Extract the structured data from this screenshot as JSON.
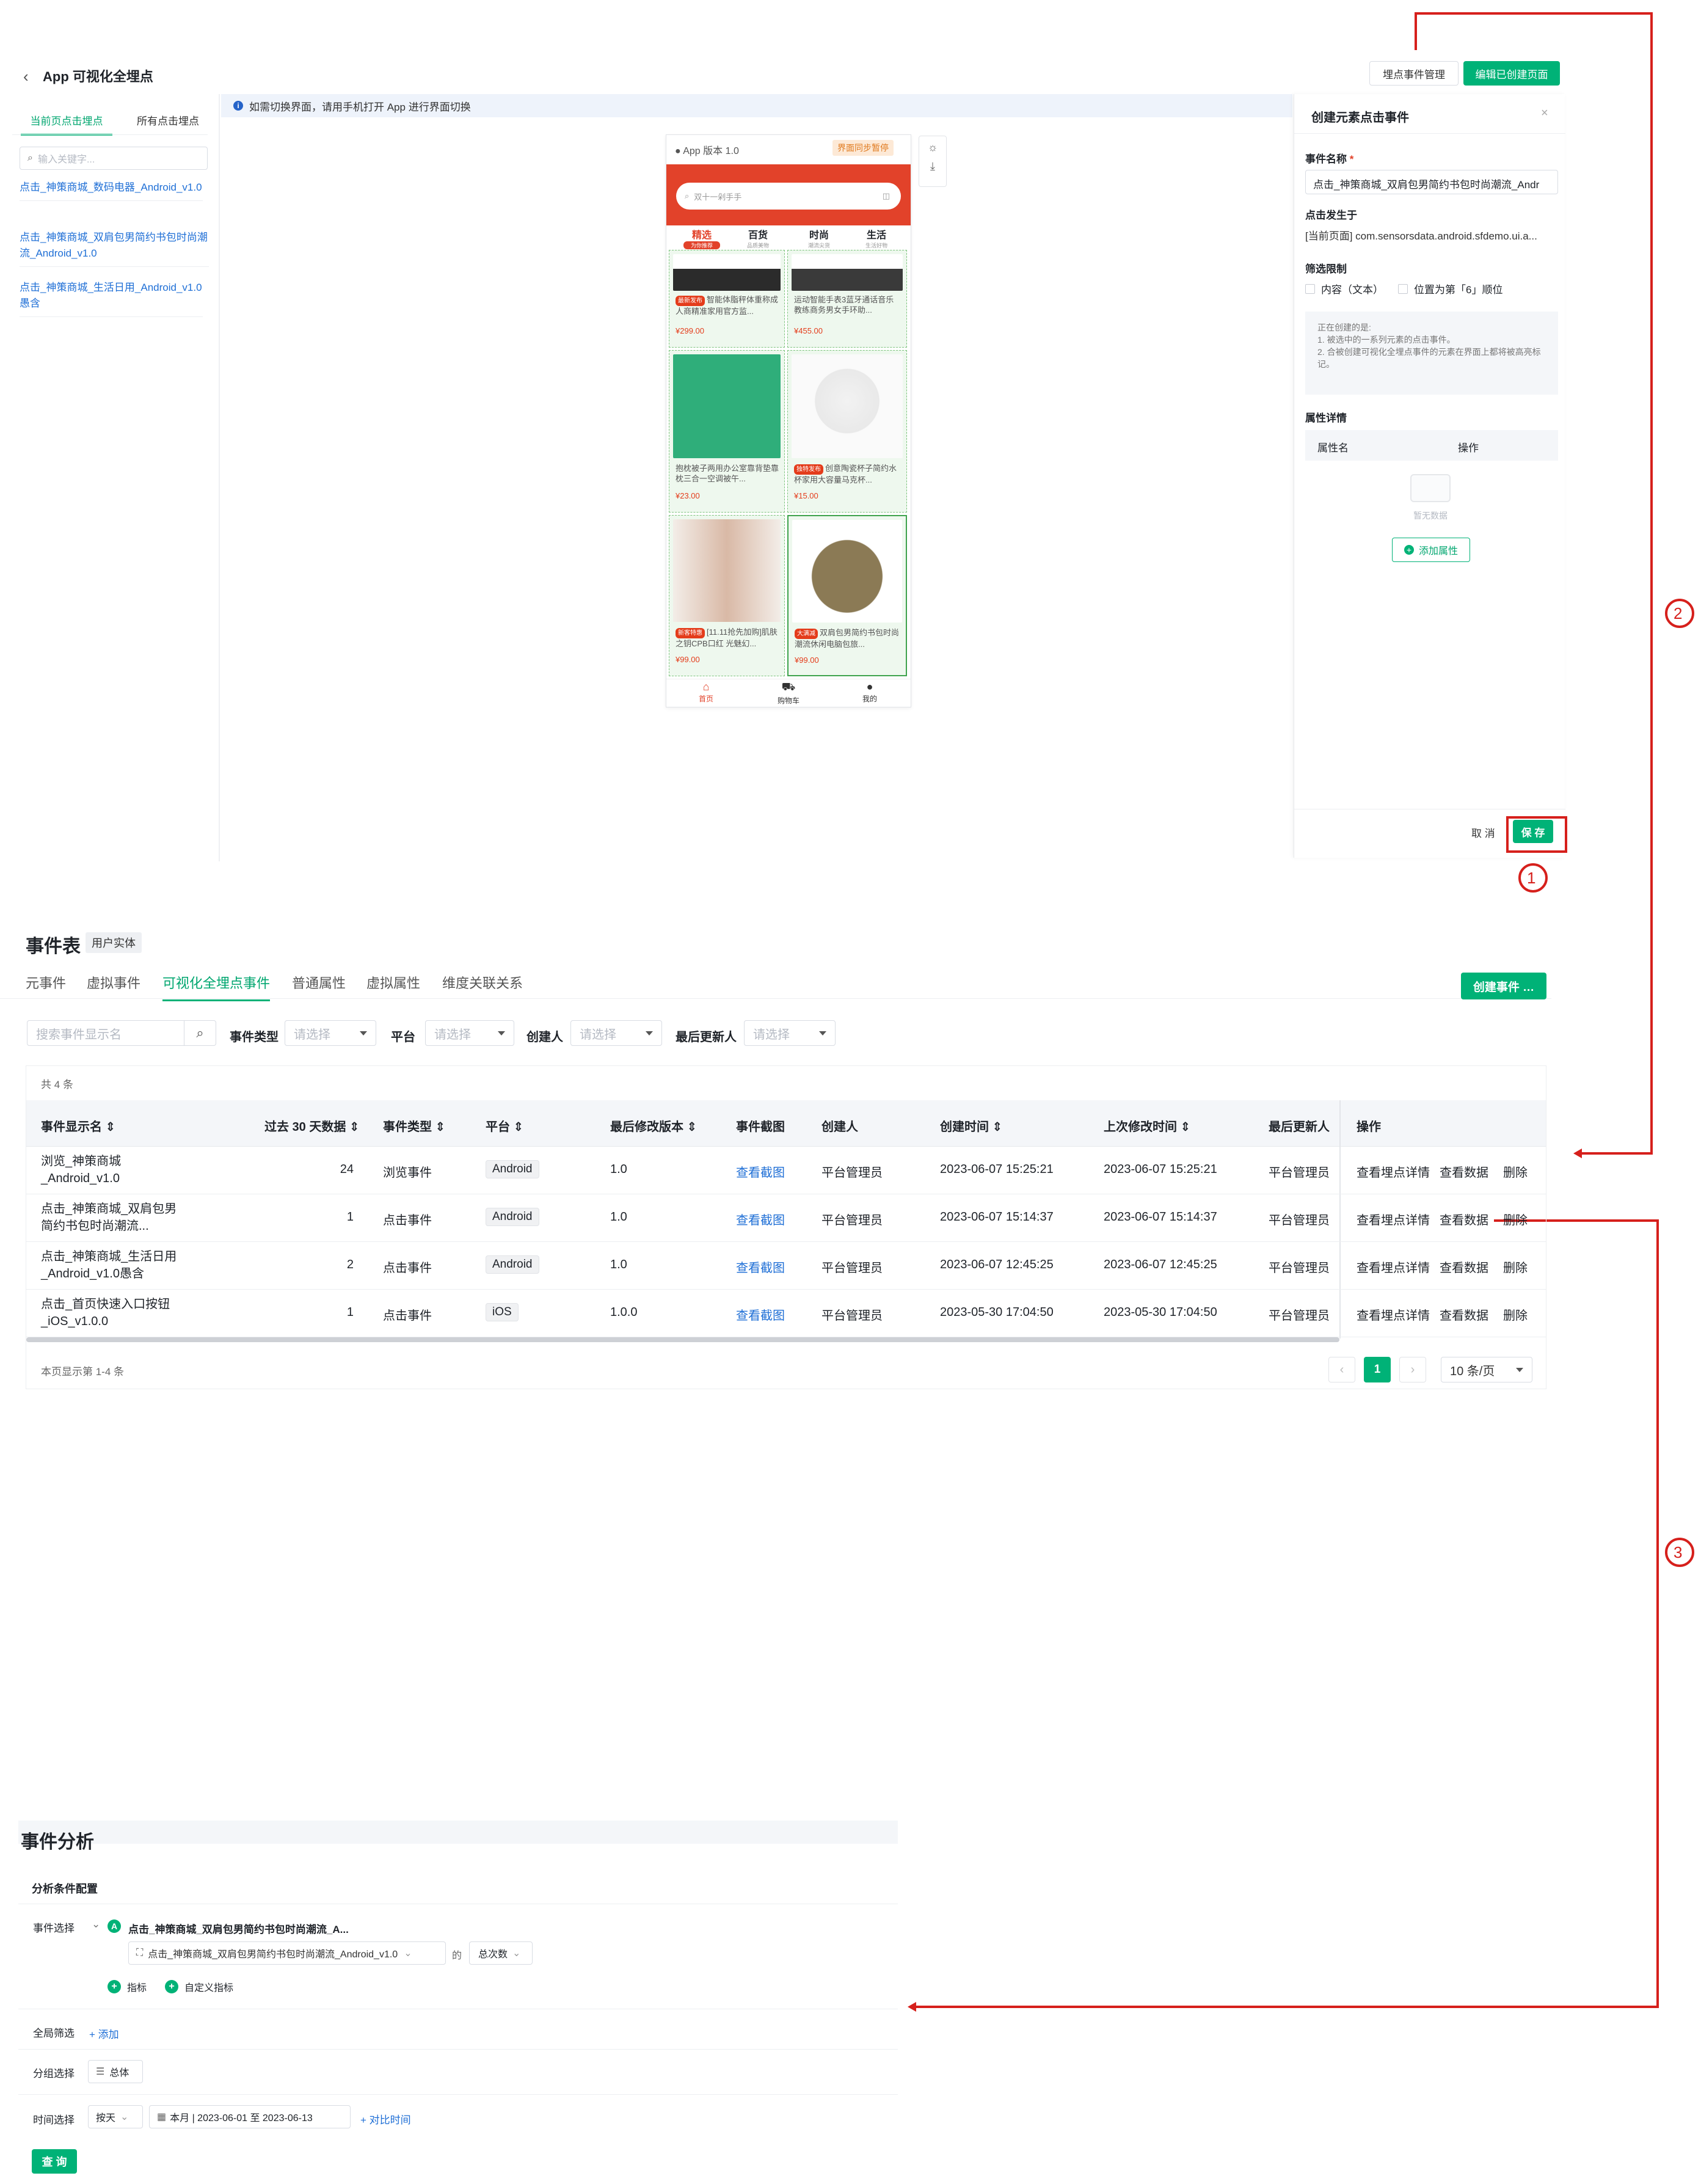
{
  "top": {
    "back_title": "App 可视化全埋点",
    "btn_manage": "埋点事件管理",
    "btn_edit": "编辑已创建页面",
    "tab_current": "当前页点击埋点",
    "tab_all": "所有点击埋点",
    "search_placeholder": "输入关键字...",
    "list": [
      "点击_神策商城_数码电器_Android_v1.0",
      "点击_神策商城_双肩包男简约书包时尚潮流_Android_v1.0",
      "点击_神策商城_生活日用_Android_v1.0愚含"
    ],
    "notice": "如需切换界面，请用手机打开 App 进行界面切换",
    "phone": {
      "version": "App 版本 1.0",
      "sync": "界面同步暂停",
      "search": "双十一剁手手",
      "cats": [
        {
          "name": "精选",
          "sub": "为你推荐"
        },
        {
          "name": "百货",
          "sub": "品质美物"
        },
        {
          "name": "时尚",
          "sub": "潮流尖货"
        },
        {
          "name": "生活",
          "sub": "生活好物"
        }
      ],
      "products": [
        {
          "badge": "最新发布",
          "title": "智能体脂秤体重称成人商精准家用官方监...",
          "price": "¥299.00"
        },
        {
          "badge": "",
          "title": "运动智能手表3蓝牙通话音乐教练商务男女手环助...",
          "price": "¥455.00"
        },
        {
          "badge": "",
          "title": "抱枕被子两用办公室靠背垫靠枕三合一空调被午...",
          "price": "¥23.00"
        },
        {
          "badge": "独特发布",
          "title": "创意陶瓷杯子简约水杯家用大容量马克杯...",
          "price": "¥15.00"
        },
        {
          "badge": "新客特惠",
          "title": "[11.11抢先加购]肌肤之钥CPB口红 光魅幻...",
          "price": "¥99.00"
        },
        {
          "badge": "大满减",
          "title": "双肩包男简约书包时尚潮流休闲电脑包旅...",
          "price": "¥99.00"
        }
      ],
      "nav": [
        "首页",
        "购物车",
        "我的"
      ]
    },
    "panel": {
      "title": "创建元素点击事件",
      "name_label": "事件名称",
      "name_value": "点击_神策商城_双肩包男简约书包时尚潮流_Andr",
      "occur_label": "点击发生于",
      "occur_value": "[当前页面] com.sensorsdata.android.sfdemo.ui.a...",
      "filter_label": "筛选限制",
      "filter_content": "内容（文本）",
      "filter_position": "位置为第「6」顺位",
      "hint": [
        "正在创建的是:",
        "1. 被选中的一系列元素的点击事件。",
        "2. 合被创建可视化全埋点事件的元素在界面上都将被高亮标记。"
      ],
      "attr_label": "属性详情",
      "attr_col1": "属性名",
      "attr_col2": "操作",
      "empty": "暂无数据",
      "add_attr": "添加属性",
      "cancel": "取 消",
      "save": "保 存"
    }
  },
  "markers": [
    "①",
    "②",
    "③"
  ],
  "events": {
    "title": "事件表",
    "entity": "用户实体",
    "tabs": [
      "元事件",
      "虚拟事件",
      "可视化全埋点事件",
      "普通属性",
      "虚拟属性",
      "维度关联关系"
    ],
    "create_btn": "创建事件 …",
    "search_placeholder": "搜索事件显示名",
    "filters": [
      {
        "label": "事件类型",
        "placeholder": "请选择"
      },
      {
        "label": "平台",
        "placeholder": "请选择"
      },
      {
        "label": "创建人",
        "placeholder": "请选择"
      },
      {
        "label": "最后更新人",
        "placeholder": "请选择"
      }
    ],
    "total": "共 4 条",
    "columns": [
      "事件显示名",
      "过去 30 天数据",
      "事件类型",
      "平台",
      "最后修改版本",
      "事件截图",
      "创建人",
      "创建时间",
      "上次修改时间",
      "最后更新人",
      "操作"
    ],
    "rows": [
      {
        "name1": "浏览_神策商城",
        "name2": "_Android_v1.0",
        "count": "24",
        "type": "浏览事件",
        "platform": "Android",
        "version": "1.0",
        "shot": "查看截图",
        "creator": "平台管理员",
        "created": "2023-06-07 15:25:21",
        "modified": "2023-06-07 15:25:21",
        "updater": "平台管理员"
      },
      {
        "name1": "点击_神策商城_双肩包男",
        "name2": "简约书包时尚潮流...",
        "count": "1",
        "type": "点击事件",
        "platform": "Android",
        "version": "1.0",
        "shot": "查看截图",
        "creator": "平台管理员",
        "created": "2023-06-07 15:14:37",
        "modified": "2023-06-07 15:14:37",
        "updater": "平台管理员"
      },
      {
        "name1": "点击_神策商城_生活日用",
        "name2": "_Android_v1.0愚含",
        "count": "2",
        "type": "点击事件",
        "platform": "Android",
        "version": "1.0",
        "shot": "查看截图",
        "creator": "平台管理员",
        "created": "2023-06-07 12:45:25",
        "modified": "2023-06-07 12:45:25",
        "updater": "平台管理员"
      },
      {
        "name1": "点击_首页快速入口按钮",
        "name2": "_iOS_v1.0.0",
        "count": "1",
        "type": "点击事件",
        "platform": "iOS",
        "version": "1.0.0",
        "shot": "查看截图",
        "creator": "平台管理员",
        "created": "2023-05-30 17:04:50",
        "modified": "2023-05-30 17:04:50",
        "updater": "平台管理员"
      }
    ],
    "actions": [
      "查看埋点详情",
      "查看数据",
      "删除"
    ],
    "page_info": "本页显示第 1-4 条",
    "page": "1",
    "page_size": "10 条/页"
  },
  "analysis": {
    "title": "事件分析",
    "config": "分析条件配置",
    "event_label": "事件选择",
    "event_letter": "A",
    "event_name": "点击_神策商城_双肩包男简约书包时尚潮流_A...",
    "event_select": "点击_神策商城_双肩包男简约书包时尚潮流_Android_v1.0",
    "of": "的",
    "metric": "总次数",
    "add_metric": "指标",
    "custom_metric": "自定义指标",
    "global_label": "全局筛选",
    "global_add": "+ 添加",
    "group_label": "分组选择",
    "group_value": "总体",
    "time_label": "时间选择",
    "time_unit": "按天",
    "time_range": "本月 | 2023-06-01 至 2023-06-13",
    "compare": "+ 对比时间",
    "query": "查 询"
  }
}
